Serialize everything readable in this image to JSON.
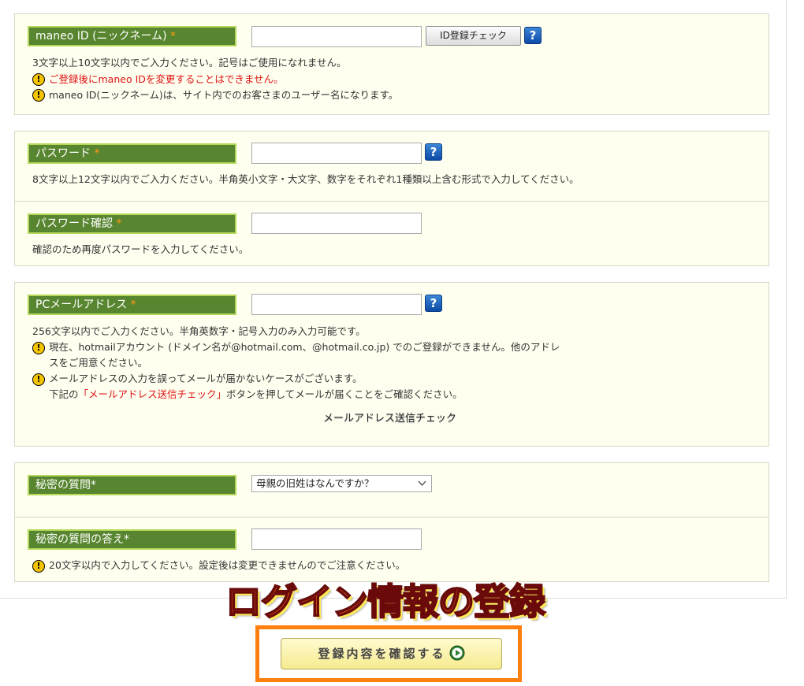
{
  "nickname": {
    "label": "maneo ID (ニックネーム)",
    "required_mark": "*",
    "value": "",
    "check_button": "ID登録チェック",
    "help_icon": "?",
    "note": "3文字以上10文字以内でご入力ください。記号はご使用になれません。",
    "warning_red": "ご登録後にmaneo IDを変更することはできません。",
    "warning": "maneo ID(ニックネーム)は、サイト内でのお客さまのユーザー名になります。"
  },
  "password": {
    "label": "パスワード",
    "required_mark": "*",
    "value": "",
    "help_icon": "?",
    "note": "8文字以上12文字以内でご入力ください。半角英小文字・大文字、数字をそれぞれ1種類以上含む形式で入力してください。"
  },
  "password_confirm": {
    "label": "パスワード確認",
    "required_mark": "*",
    "value": "",
    "note": "確認のため再度パスワードを入力してください。"
  },
  "email": {
    "label": "PCメールアドレス",
    "required_mark": "*",
    "value": "",
    "help_icon": "?",
    "note": "256文字以内でご入力ください。半角英数字・記号入力のみ入力可能です。",
    "warning1_line1": "現在、hotmailアカウント (ドメイン名が@hotmail.com、@hotmail.co.jp) でのご登録ができません。他のアドレ",
    "warning1_line2": "スをご用意ください。",
    "warning2_line1": "メールアドレスの入力を誤ってメールが届かないケースがございます。",
    "warning2_prefix": "下記の",
    "warning2_highlight": "「メールアドレス送信チェック」",
    "warning2_suffix": "ボタンを押してメールが届くことをご確認ください。",
    "check_button": "メールアドレス送信チェック"
  },
  "secret_question": {
    "label": "秘密の質問*",
    "selected": "母親の旧姓はなんですか？"
  },
  "secret_answer": {
    "label": "秘密の質問の答え*",
    "value": "",
    "warning": "20文字以内で入力してください。設定後は変更できませんのでご注意ください。"
  },
  "warning_icon": "!",
  "overlay_title": "ログイン情報の登録",
  "confirm_button": "登録内容を確認する",
  "colors": {
    "label_bg": "#58852f",
    "label_border": "#b5d85a",
    "required": "#ff9c1a",
    "warning_text": "#dd1111",
    "section_bg": "#fffff0",
    "highlight_frame": "#ff7f0f",
    "title_fill": "#ff7a1a"
  }
}
